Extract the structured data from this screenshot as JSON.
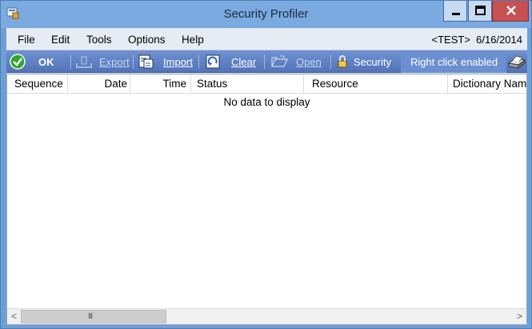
{
  "window": {
    "title": "Security Profiler",
    "colors": {
      "title_bar": "#7aaae0",
      "toolbar": "#5b7ec4",
      "close": "#c75050"
    }
  },
  "menubar": {
    "items": [
      "File",
      "Edit",
      "Tools",
      "Options",
      "Help"
    ],
    "company": "<TEST>",
    "date": "6/16/2014"
  },
  "toolbar": {
    "ok": "OK",
    "export": "Export",
    "import": "Import",
    "clear": "Clear",
    "open": "Open",
    "security": "Security",
    "status": "Right click enabled"
  },
  "grid": {
    "columns": [
      "Sequence",
      "Date",
      "Time",
      "Status",
      "Resource",
      "Dictionary Nam"
    ],
    "empty_message": "No data to display"
  },
  "scrollbar": {
    "grip": "III",
    "left_arrow": "<",
    "right_arrow": ">"
  }
}
